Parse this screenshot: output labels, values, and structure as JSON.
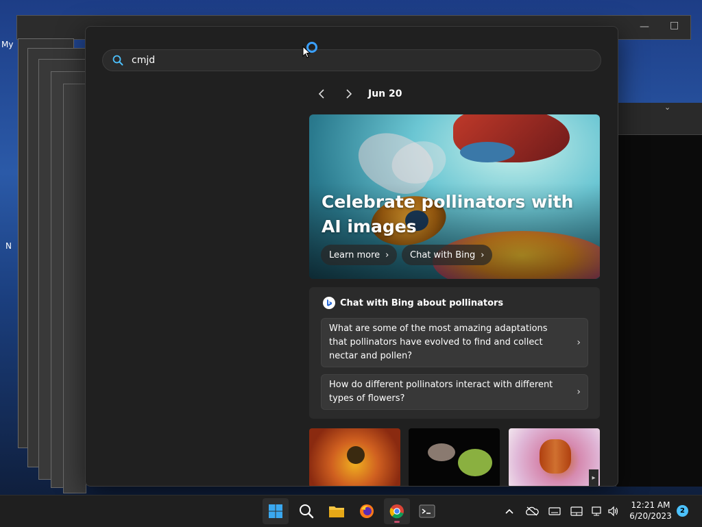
{
  "desktop": {
    "labels": [
      "My",
      "N"
    ]
  },
  "search": {
    "query": "cmjd"
  },
  "feed": {
    "date": "Jun 20",
    "hero": {
      "title": "Celebrate pollinators with AI images",
      "learn_more": "Learn more",
      "chat_with_bing": "Chat with Bing"
    },
    "chat": {
      "heading": "Chat with Bing about pollinators",
      "questions": [
        "What are some of the most amazing adaptations that pollinators have evolved to find and collect nectar and pollen?",
        "How do different pollinators interact with different types of flowers?"
      ]
    }
  },
  "taskbar": {
    "time": "12:21 AM",
    "date": "6/20/2023",
    "notifications": "2"
  },
  "colors": {
    "accent": "#4cc2ff",
    "panel": "#202020",
    "card": "#2b2b2b"
  }
}
